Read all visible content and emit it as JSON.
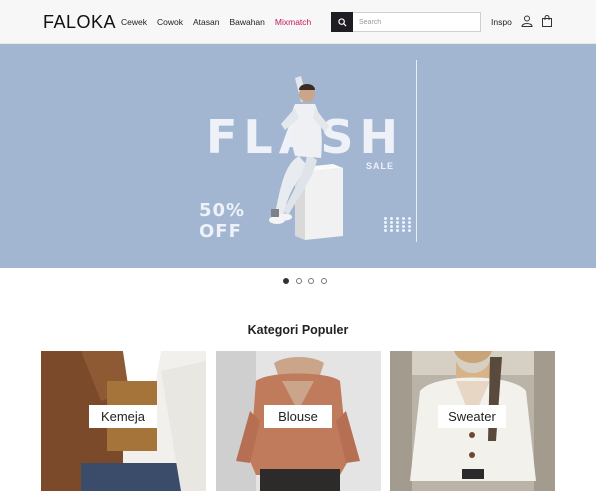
{
  "header": {
    "logo": "FALOKA",
    "nav": [
      {
        "label": "Cewek"
      },
      {
        "label": "Cowok"
      },
      {
        "label": "Atasan"
      },
      {
        "label": "Bawahan"
      },
      {
        "label": "Mixmatch"
      }
    ],
    "search_placeholder": "Search",
    "inspo_label": "Inspo",
    "accent_color": "#c2185b"
  },
  "banner": {
    "title": "FLASH",
    "subtitle": "SALE",
    "discount_line1": "50%",
    "discount_line2": "OFF",
    "background_color": "#a2b6d1"
  },
  "carousel": {
    "active_index": 0,
    "count": 4
  },
  "categories": {
    "title": "Kategori Populer",
    "items": [
      {
        "label": "Kemeja"
      },
      {
        "label": "Blouse"
      },
      {
        "label": "Sweater"
      }
    ]
  }
}
